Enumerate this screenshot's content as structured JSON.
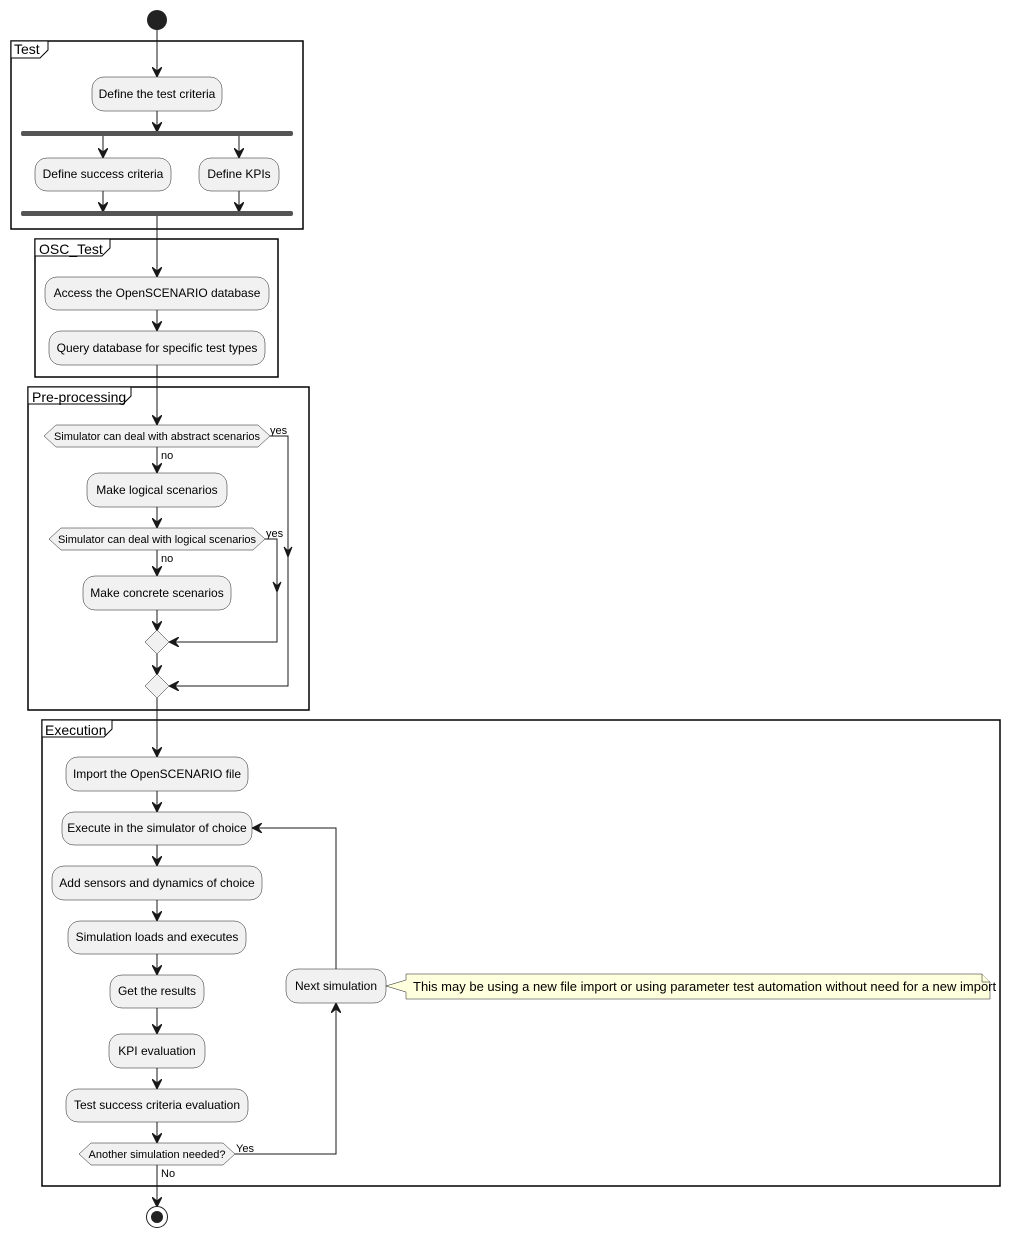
{
  "diagram": {
    "type": "uml-activity-diagram",
    "colors": {
      "node_fill": "#f1f1f1",
      "node_stroke": "#181818",
      "bar_fill": "#555555",
      "note_fill": "#feffdd",
      "start_fill": "#222222"
    },
    "frames": {
      "test": "Test",
      "osc_test": "OSC_Test",
      "preprocessing": "Pre-processing",
      "execution": "Execution"
    },
    "nodes": {
      "define_test_criteria": "Define the test criteria",
      "define_success_criteria": "Define success criteria",
      "define_kpis": "Define KPIs",
      "access_db": "Access the OpenSCENARIO database",
      "query_db": "Query database for specific test types",
      "decision_abstract": "Simulator can deal with abstract scenarios",
      "make_logical": "Make logical scenarios",
      "decision_logical": "Simulator can deal with logical scenarios",
      "make_concrete": "Make concrete scenarios",
      "import_file": "Import the OpenSCENARIO file",
      "execute_sim": "Execute in the simulator of choice",
      "add_sensors": "Add sensors and dynamics of choice",
      "sim_loads": "Simulation loads and executes",
      "get_results": "Get the results",
      "kpi_eval": "KPI evaluation",
      "success_eval": "Test success criteria evaluation",
      "decision_another": "Another simulation needed?",
      "next_sim": "Next simulation"
    },
    "edge_labels": {
      "abstract_yes": "yes",
      "abstract_no": "no",
      "logical_yes": "yes",
      "logical_no": "no",
      "another_yes": "Yes",
      "another_no": "No"
    },
    "note": "This may be using a new file import or using parameter test automation without need for a new import"
  }
}
